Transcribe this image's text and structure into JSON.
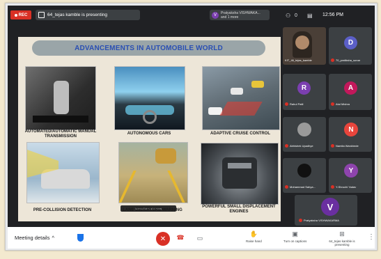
{
  "topbar": {
    "rec_label": "REC",
    "presenting_text": "64_tejas kamble is presenting",
    "speaker_name": "Pratyaksha VISHWAKA...",
    "speaker_sub": "and 1 more",
    "speaker_initial": "V",
    "time": "12:56 PM"
  },
  "slide": {
    "title": "ADVANCEMENTS IN AUTOMOBILE WORLD",
    "captions": [
      "AUTOMATED/AUTOMATIC MANUAL TRANSMISSION",
      "AUTONOMOUS CARS",
      "ADAPTIVE CRUISE CONTROL",
      "PRE-COLLISION DETECTION",
      "LANE DEPARTURE WARNING",
      "POWERFUL SMALL DISPLACEMENT ENGINES"
    ],
    "camera_strip": "Instructions fill details"
  },
  "participants": [
    {
      "name": "KIT_46_tejas_kamble",
      "initial": "",
      "color": "#5a4a3a"
    },
    {
      "name": "70_pratiksha_sonar",
      "initial": "D",
      "color": "#5b5fc7"
    },
    {
      "name": "Rahul Patil",
      "initial": "R",
      "color": "#7b3fb0"
    },
    {
      "name": "Atul Mishra",
      "initial": "A",
      "color": "#c2185b"
    },
    {
      "name": "Abhishek Upadhye",
      "initial": "",
      "color": "#6a6a6a"
    },
    {
      "name": "Namita Wankhede",
      "initial": "N",
      "color": "#e8453c"
    },
    {
      "name": "Mohammad Sahya...",
      "initial": "",
      "color": "#2e2e2e"
    },
    {
      "name": "Y-Shruchi Yadav",
      "initial": "Y",
      "color": "#8e44ad"
    },
    {
      "name": "Pratyaksha VISHWAKARMA",
      "initial": "V",
      "color": "#6a2fa0"
    }
  ],
  "bottombar": {
    "meeting_details": "Meeting details",
    "raise_hand": "Raise hand",
    "captions": "Turn on captions",
    "presenting": "64_tejas kamble is presenting"
  },
  "colors": {
    "accent_red": "#d93025",
    "meet_bg": "#202124",
    "title_blue": "#2a4fb3"
  }
}
